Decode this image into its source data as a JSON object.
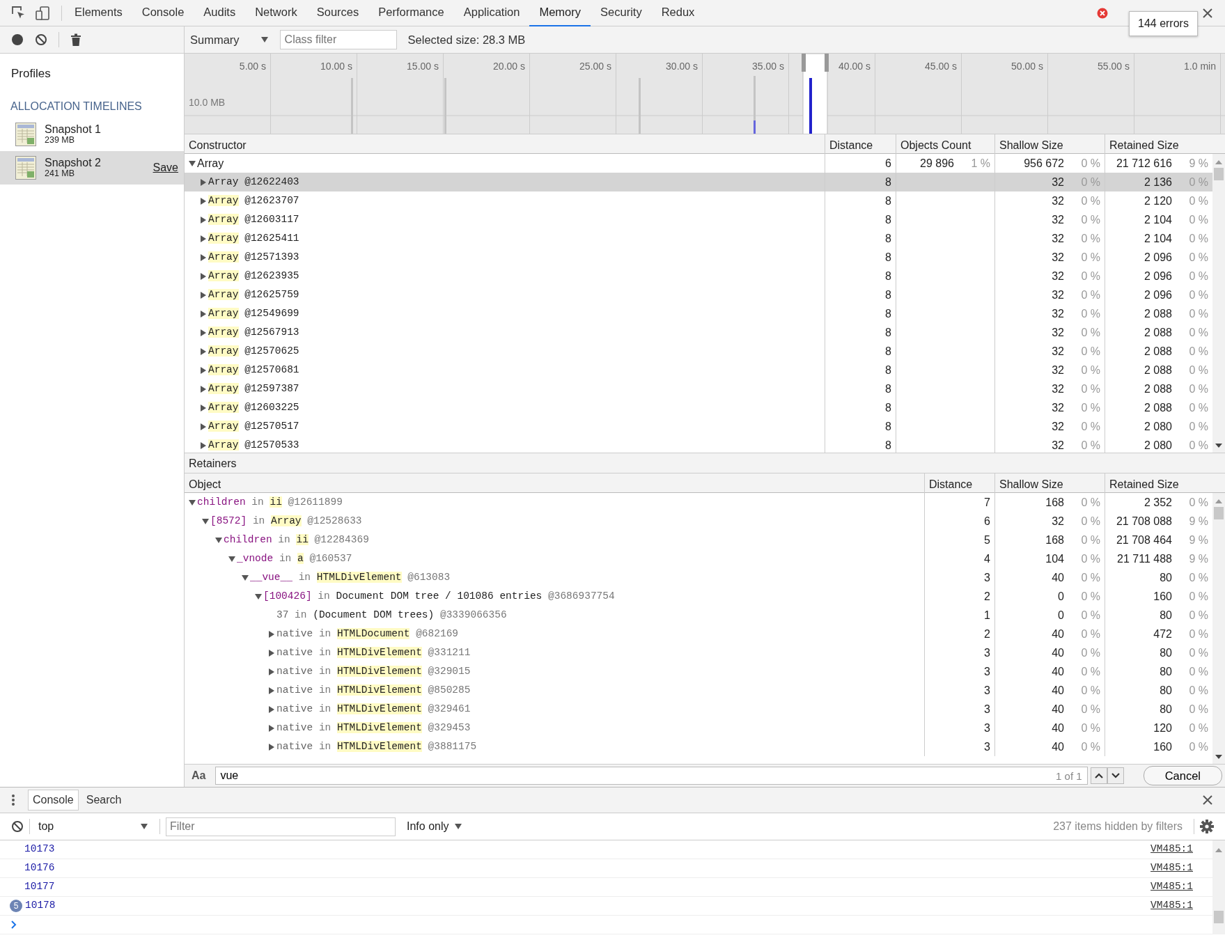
{
  "toolbar": {
    "tabs": [
      {
        "label": "Elements",
        "selected": false
      },
      {
        "label": "Console",
        "selected": false
      },
      {
        "label": "Audits",
        "selected": false
      },
      {
        "label": "Network",
        "selected": false
      },
      {
        "label": "Sources",
        "selected": false
      },
      {
        "label": "Performance",
        "selected": false
      },
      {
        "label": "Application",
        "selected": false
      },
      {
        "label": "Memory",
        "selected": true
      },
      {
        "label": "Security",
        "selected": false
      },
      {
        "label": "Redux",
        "selected": false
      }
    ],
    "error_tooltip": "144 errors"
  },
  "sidebar": {
    "title": "Profiles",
    "section": "ALLOCATION TIMELINES",
    "snapshots": [
      {
        "name": "Snapshot 1",
        "size": "239 MB",
        "selected": false
      },
      {
        "name": "Snapshot 2",
        "size": "241 MB",
        "selected": true,
        "action": "Save"
      }
    ]
  },
  "memory_toolbar": {
    "view": "Summary",
    "class_filter_placeholder": "Class filter",
    "selected_size": "Selected size: 28.3 MB"
  },
  "timeline": {
    "ticks": [
      "5.00 s",
      "10.00 s",
      "15.00 s",
      "20.00 s",
      "25.00 s",
      "30.00 s",
      "35.00 s",
      "40.00 s",
      "45.00 s",
      "50.00 s",
      "55.00 s",
      "1.0 min"
    ],
    "scale_label": "10.0 MB"
  },
  "constructors": {
    "columns": [
      "Constructor",
      "Distance",
      "Objects Count",
      "Shallow Size",
      "Retained Size"
    ],
    "rows": [
      {
        "name": "Array",
        "expanded": true,
        "selected": false,
        "distance": "6",
        "count": "29 896",
        "count_pct": "1 %",
        "shallow": "956 672",
        "shallow_pct": "0 %",
        "retained": "21 712 616",
        "retained_pct": "9 %",
        "children": [
          {
            "name": "Array",
            "id": "@12622403",
            "highlighted": false,
            "expanded": false,
            "selected": true,
            "distance": "8",
            "shallow": "32",
            "shallow_pct": "0 %",
            "retained": "2 136",
            "retained_pct": "0 %"
          },
          {
            "name": "Array",
            "id": "@12623707",
            "highlighted": true,
            "expanded": false,
            "selected": false,
            "distance": "8",
            "shallow": "32",
            "shallow_pct": "0 %",
            "retained": "2 120",
            "retained_pct": "0 %"
          },
          {
            "name": "Array",
            "id": "@12603117",
            "highlighted": true,
            "expanded": false,
            "selected": false,
            "distance": "8",
            "shallow": "32",
            "shallow_pct": "0 %",
            "retained": "2 104",
            "retained_pct": "0 %"
          },
          {
            "name": "Array",
            "id": "@12625411",
            "highlighted": true,
            "expanded": false,
            "selected": false,
            "distance": "8",
            "shallow": "32",
            "shallow_pct": "0 %",
            "retained": "2 104",
            "retained_pct": "0 %"
          },
          {
            "name": "Array",
            "id": "@12571393",
            "highlighted": true,
            "expanded": false,
            "selected": false,
            "distance": "8",
            "shallow": "32",
            "shallow_pct": "0 %",
            "retained": "2 096",
            "retained_pct": "0 %"
          },
          {
            "name": "Array",
            "id": "@12623935",
            "highlighted": true,
            "expanded": false,
            "selected": false,
            "distance": "8",
            "shallow": "32",
            "shallow_pct": "0 %",
            "retained": "2 096",
            "retained_pct": "0 %"
          },
          {
            "name": "Array",
            "id": "@12625759",
            "highlighted": true,
            "expanded": false,
            "selected": false,
            "distance": "8",
            "shallow": "32",
            "shallow_pct": "0 %",
            "retained": "2 096",
            "retained_pct": "0 %"
          },
          {
            "name": "Array",
            "id": "@12549699",
            "highlighted": true,
            "expanded": false,
            "selected": false,
            "distance": "8",
            "shallow": "32",
            "shallow_pct": "0 %",
            "retained": "2 088",
            "retained_pct": "0 %"
          },
          {
            "name": "Array",
            "id": "@12567913",
            "highlighted": true,
            "expanded": false,
            "selected": false,
            "distance": "8",
            "shallow": "32",
            "shallow_pct": "0 %",
            "retained": "2 088",
            "retained_pct": "0 %"
          },
          {
            "name": "Array",
            "id": "@12570625",
            "highlighted": true,
            "expanded": false,
            "selected": false,
            "distance": "8",
            "shallow": "32",
            "shallow_pct": "0 %",
            "retained": "2 088",
            "retained_pct": "0 %"
          },
          {
            "name": "Array",
            "id": "@12570681",
            "highlighted": true,
            "expanded": false,
            "selected": false,
            "distance": "8",
            "shallow": "32",
            "shallow_pct": "0 %",
            "retained": "2 088",
            "retained_pct": "0 %"
          },
          {
            "name": "Array",
            "id": "@12597387",
            "highlighted": true,
            "expanded": false,
            "selected": false,
            "distance": "8",
            "shallow": "32",
            "shallow_pct": "0 %",
            "retained": "2 088",
            "retained_pct": "0 %"
          },
          {
            "name": "Array",
            "id": "@12603225",
            "highlighted": true,
            "expanded": false,
            "selected": false,
            "distance": "8",
            "shallow": "32",
            "shallow_pct": "0 %",
            "retained": "2 088",
            "retained_pct": "0 %"
          },
          {
            "name": "Array",
            "id": "@12570517",
            "highlighted": true,
            "expanded": false,
            "selected": false,
            "distance": "8",
            "shallow": "32",
            "shallow_pct": "0 %",
            "retained": "2 080",
            "retained_pct": "0 %"
          },
          {
            "name": "Array",
            "id": "@12570533",
            "highlighted": true,
            "expanded": false,
            "selected": false,
            "distance": "8",
            "shallow": "32",
            "shallow_pct": "0 %",
            "retained": "2 080",
            "retained_pct": "0 %"
          }
        ]
      }
    ]
  },
  "retainers": {
    "title": "Retainers",
    "columns": [
      "Object",
      "Distance",
      "Shallow Size",
      "Retained Size"
    ],
    "rows": [
      {
        "edge": "children",
        "internal": false,
        "link": "in",
        "owner": "ii",
        "highlighted": true,
        "id": "@12611899",
        "expandable": true,
        "expanded": true,
        "distance": "7",
        "shallow": "168",
        "shallow_pct": "0 %",
        "retained": "2 352",
        "retained_pct": "0 %",
        "children": [
          {
            "edge": "[8572]",
            "internal": false,
            "link": "in",
            "owner": "Array",
            "highlighted": true,
            "id": "@12528633",
            "expandable": true,
            "expanded": true,
            "distance": "6",
            "shallow": "32",
            "shallow_pct": "0 %",
            "retained": "21 708 088",
            "retained_pct": "9 %",
            "children": [
              {
                "edge": "children",
                "internal": false,
                "link": "in",
                "owner": "ii",
                "highlighted": true,
                "id": "@12284369",
                "expandable": true,
                "expanded": true,
                "distance": "5",
                "shallow": "168",
                "shallow_pct": "0 %",
                "retained": "21 708 464",
                "retained_pct": "9 %",
                "children": [
                  {
                    "edge": "_vnode",
                    "internal": false,
                    "link": "in",
                    "owner": "a",
                    "highlighted": true,
                    "id": "@160537",
                    "expandable": true,
                    "expanded": true,
                    "distance": "4",
                    "shallow": "104",
                    "shallow_pct": "0 %",
                    "retained": "21 711 488",
                    "retained_pct": "9 %",
                    "children": [
                      {
                        "edge": "__vue__",
                        "internal": false,
                        "link": "in",
                        "owner": "HTMLDivElement",
                        "highlighted": true,
                        "id": "@613083",
                        "expandable": true,
                        "expanded": true,
                        "distance": "3",
                        "shallow": "40",
                        "shallow_pct": "0 %",
                        "retained": "80",
                        "retained_pct": "0 %",
                        "children": [
                          {
                            "edge": "[100426]",
                            "internal": false,
                            "link": "in",
                            "owner": "Document DOM tree / 101086 entries",
                            "highlighted": false,
                            "id": "@3686937754",
                            "expandable": true,
                            "expanded": true,
                            "distance": "2",
                            "shallow": "0",
                            "shallow_pct": "0 %",
                            "retained": "160",
                            "retained_pct": "0 %",
                            "children": [
                              {
                                "edge": "37",
                                "internal": true,
                                "link": "in",
                                "owner": "(Document DOM trees)",
                                "highlighted": false,
                                "id": "@3339066356",
                                "expandable": false,
                                "distance": "1",
                                "shallow": "0",
                                "shallow_pct": "0 %",
                                "retained": "80",
                                "retained_pct": "0 %"
                              },
                              {
                                "edge": "native",
                                "internal": true,
                                "link": "in",
                                "owner": "HTMLDocument",
                                "highlighted": true,
                                "id": "@682169",
                                "expandable": true,
                                "expanded": false,
                                "distance": "2",
                                "shallow": "40",
                                "shallow_pct": "0 %",
                                "retained": "472",
                                "retained_pct": "0 %"
                              },
                              {
                                "edge": "native",
                                "internal": true,
                                "link": "in",
                                "owner": "HTMLDivElement",
                                "highlighted": true,
                                "id": "@331211",
                                "expandable": true,
                                "expanded": false,
                                "distance": "3",
                                "shallow": "40",
                                "shallow_pct": "0 %",
                                "retained": "80",
                                "retained_pct": "0 %"
                              },
                              {
                                "edge": "native",
                                "internal": true,
                                "link": "in",
                                "owner": "HTMLDivElement",
                                "highlighted": true,
                                "id": "@329015",
                                "expandable": true,
                                "expanded": false,
                                "distance": "3",
                                "shallow": "40",
                                "shallow_pct": "0 %",
                                "retained": "80",
                                "retained_pct": "0 %"
                              },
                              {
                                "edge": "native",
                                "internal": true,
                                "link": "in",
                                "owner": "HTMLDivElement",
                                "highlighted": true,
                                "id": "@850285",
                                "expandable": true,
                                "expanded": false,
                                "distance": "3",
                                "shallow": "40",
                                "shallow_pct": "0 %",
                                "retained": "80",
                                "retained_pct": "0 %"
                              },
                              {
                                "edge": "native",
                                "internal": true,
                                "link": "in",
                                "owner": "HTMLDivElement",
                                "highlighted": true,
                                "id": "@329461",
                                "expandable": true,
                                "expanded": false,
                                "distance": "3",
                                "shallow": "40",
                                "shallow_pct": "0 %",
                                "retained": "80",
                                "retained_pct": "0 %"
                              },
                              {
                                "edge": "native",
                                "internal": true,
                                "link": "in",
                                "owner": "HTMLDivElement",
                                "highlighted": true,
                                "id": "@329453",
                                "expandable": true,
                                "expanded": false,
                                "distance": "3",
                                "shallow": "40",
                                "shallow_pct": "0 %",
                                "retained": "120",
                                "retained_pct": "0 %"
                              },
                              {
                                "edge": "native",
                                "internal": true,
                                "link": "in",
                                "owner": "HTMLDivElement",
                                "highlighted": true,
                                "id": "@3881175",
                                "expandable": true,
                                "expanded": false,
                                "distance": "3",
                                "shallow": "40",
                                "shallow_pct": "0 %",
                                "retained": "160",
                                "retained_pct": "0 %"
                              }
                            ]
                          }
                        ]
                      }
                    ]
                  }
                ]
              }
            ]
          }
        ]
      }
    ]
  },
  "search_bar": {
    "case_toggle": "Aa",
    "value": "vue",
    "match_count": "1 of 1",
    "cancel": "Cancel"
  },
  "console_drawer": {
    "tabs": [
      {
        "label": "Console",
        "selected": true
      },
      {
        "label": "Search",
        "selected": false
      }
    ],
    "context": "top",
    "filter_placeholder": "Filter",
    "level": "Info only",
    "hidden_count": "237 items hidden by filters",
    "messages": [
      {
        "text": "10173",
        "source": "VM485:1"
      },
      {
        "text": "10176",
        "source": "VM485:1"
      },
      {
        "text": "10177",
        "source": "VM485:1"
      },
      {
        "text": "10178",
        "source": "VM485:1",
        "repeat": "5"
      }
    ]
  }
}
